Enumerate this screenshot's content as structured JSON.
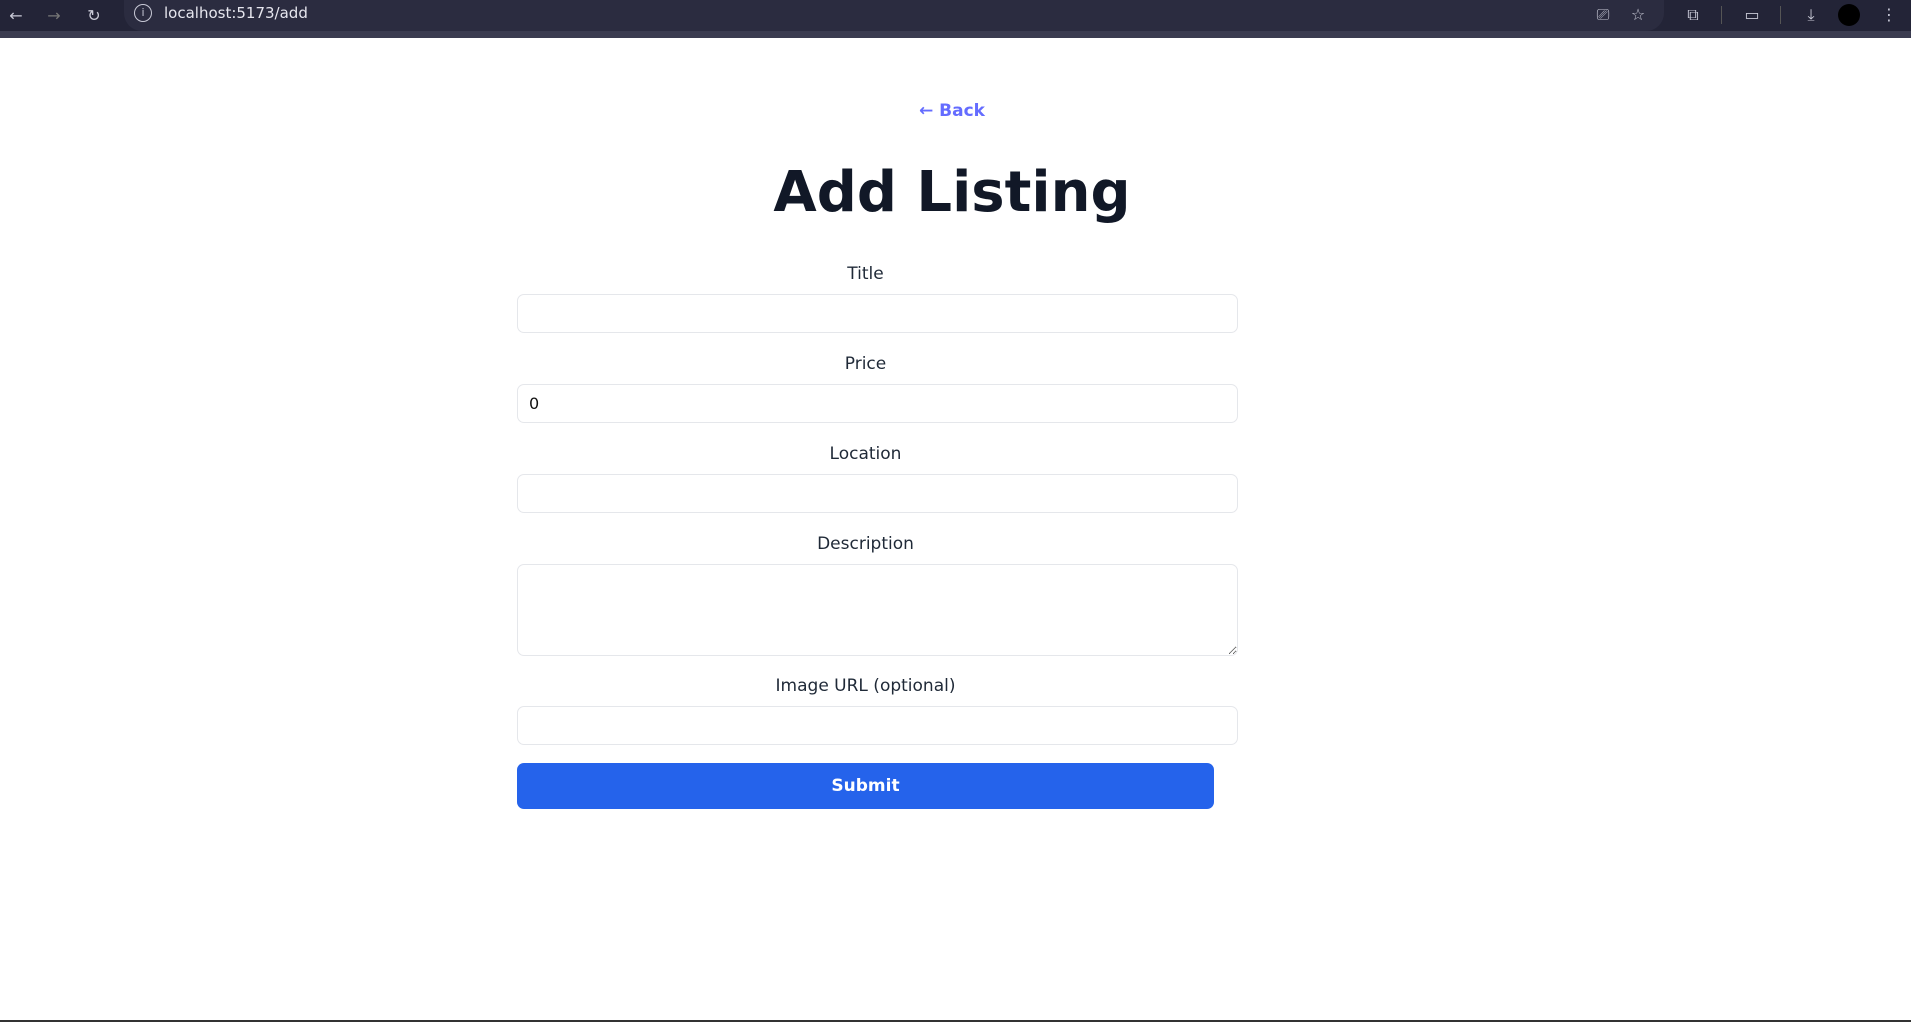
{
  "browser": {
    "url": "localhost:5173/add"
  },
  "page": {
    "back_label": "← Back",
    "title": "Add Listing",
    "fields": [
      {
        "label": "Title",
        "value": ""
      },
      {
        "label": "Price",
        "value": "0"
      },
      {
        "label": "Location",
        "value": ""
      },
      {
        "label": "Description",
        "value": ""
      },
      {
        "label": "Image URL (optional)",
        "value": ""
      }
    ],
    "submit_label": "Submit"
  },
  "colors": {
    "accent": "#2563eb",
    "link": "#646cff",
    "heading": "#111827"
  }
}
